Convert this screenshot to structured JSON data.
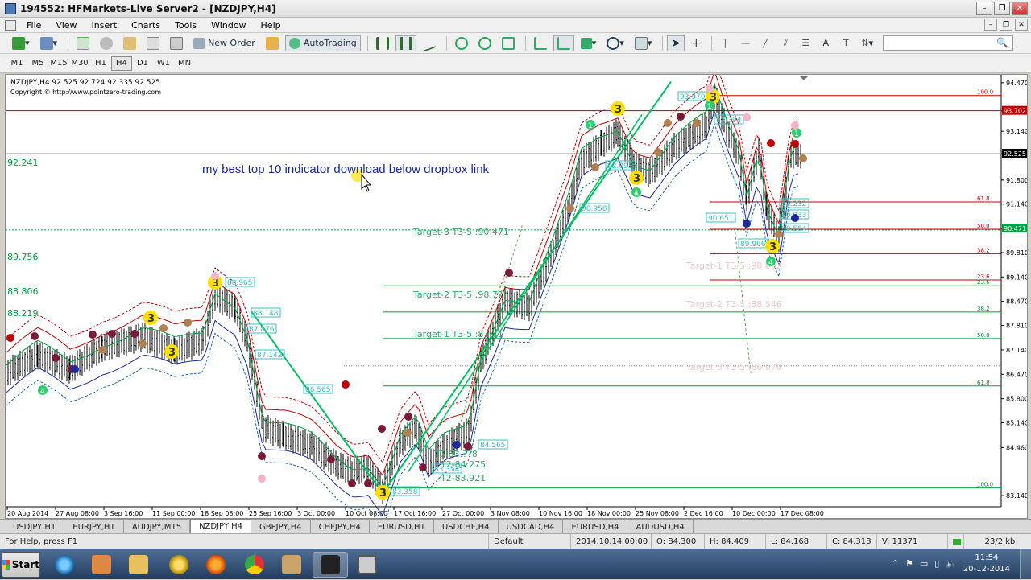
{
  "window": {
    "title": "194552: HFMarkets-Live Server2 - [NZDJPY,H4]",
    "minimize": "–",
    "restore": "❐",
    "close": "✕"
  },
  "menu": [
    "File",
    "View",
    "Insert",
    "Charts",
    "Tools",
    "Window",
    "Help"
  ],
  "toolbar": {
    "new_order": "New Order",
    "autotrading": "AutoTrading",
    "text_tool": "A"
  },
  "search": {
    "icon": "search-icon"
  },
  "timeframes": [
    "M1",
    "M5",
    "M15",
    "M30",
    "H1",
    "H4",
    "D1",
    "W1",
    "MN"
  ],
  "active_timeframe": "H4",
  "chart": {
    "header": "NZDJPY,H4  92.525 92.724 92.335 92.525",
    "copyright": "Copyright © http://www.pointzero-trading.com",
    "promo_text": "my best top 10 indicator download below dropbox link",
    "left_values": [
      "92.241",
      "89.756",
      "88.806",
      "88.219"
    ],
    "price_axis": [
      "94.470",
      "93.702",
      "93.140",
      "92.525",
      "91.800",
      "91.140",
      "90.471",
      "89.810",
      "89.140",
      "88.470",
      "87.810",
      "87.140",
      "86.470",
      "85.800",
      "85.140",
      "84.460",
      "83.140"
    ],
    "current_price": "92.525",
    "red_price": "93.702",
    "green_price": "90.471",
    "date_axis": [
      "20 Aug 2014",
      "27 Aug 08:00",
      "3 Sep 16:00",
      "11 Sep 00:00",
      "18 Sep 08:00",
      "25 Sep 16:00",
      "3 Oct 00:00",
      "10 Oct 08:00",
      "17 Oct 16:00",
      "27 Oct 00:00",
      "3 Nov 08:00",
      "10 Nov 16:00",
      "18 Nov 00:00",
      "25 Nov 08:00",
      "2 Dec 16:00",
      "10 Dec 00:00",
      "17 Dec 08:00"
    ],
    "fib_levels": [
      "100.0",
      "61.8",
      "50.0",
      "38.2",
      "23.6",
      "23.6",
      "38.2",
      "50.0",
      "61.8",
      "100.0"
    ],
    "targets_left": [
      "Target-3 T3-5 :90.471",
      "Target-2 T3-5 :98.7??",
      "Target-1 T3-5 :87.71"
    ],
    "targets_right": [
      "Target-1 T3-5 :90.062",
      "Target-2 T3-5 :88.546",
      "Target-3 T3-5 :86.670"
    ],
    "boxes": [
      "93.970",
      "93.394",
      "92.093",
      "90.958",
      "90.651",
      "89.966",
      "91.232",
      "90.933",
      "90.564",
      "88.965",
      "88.148",
      "87.876",
      "87.142",
      "86.565",
      "84.565",
      "83.354",
      "83.358"
    ],
    "t2_labels": [
      "T2-83.??8",
      "T2-84.275",
      "T2-83.921"
    ],
    "badge_3": "3",
    "badge_4": "4",
    "badge_1": "1"
  },
  "tabs": [
    "USDJPY,H1",
    "EURJPY,H1",
    "AUDJPY,M15",
    "NZDJPY,H4",
    "GBPJPY,H4",
    "CHFJPY,H4",
    "EURUSD,H1",
    "USDCHF,H4",
    "USDCAD,H4",
    "EURUSD,H4",
    "AUDUSD,H4"
  ],
  "active_tab": "NZDJPY,H4",
  "status": {
    "help": "For Help, press F1",
    "profile": "Default",
    "datetime": "2014.10.14 00:00",
    "open": "O: 84.300",
    "high": "H: 84.409",
    "low": "L: 84.168",
    "close": "C: 84.318",
    "volume": "V: 11371",
    "traffic": "23/2 kb"
  },
  "taskbar": {
    "start": "Start",
    "time": "11:54",
    "date": "20-12-2014"
  },
  "colors": {
    "bull": "#00b050",
    "bear": "#c00000",
    "fib": "#c00000",
    "target": "#00a040",
    "badge_yellow": "#ffe000",
    "mt4_bg": "#ffffff"
  }
}
